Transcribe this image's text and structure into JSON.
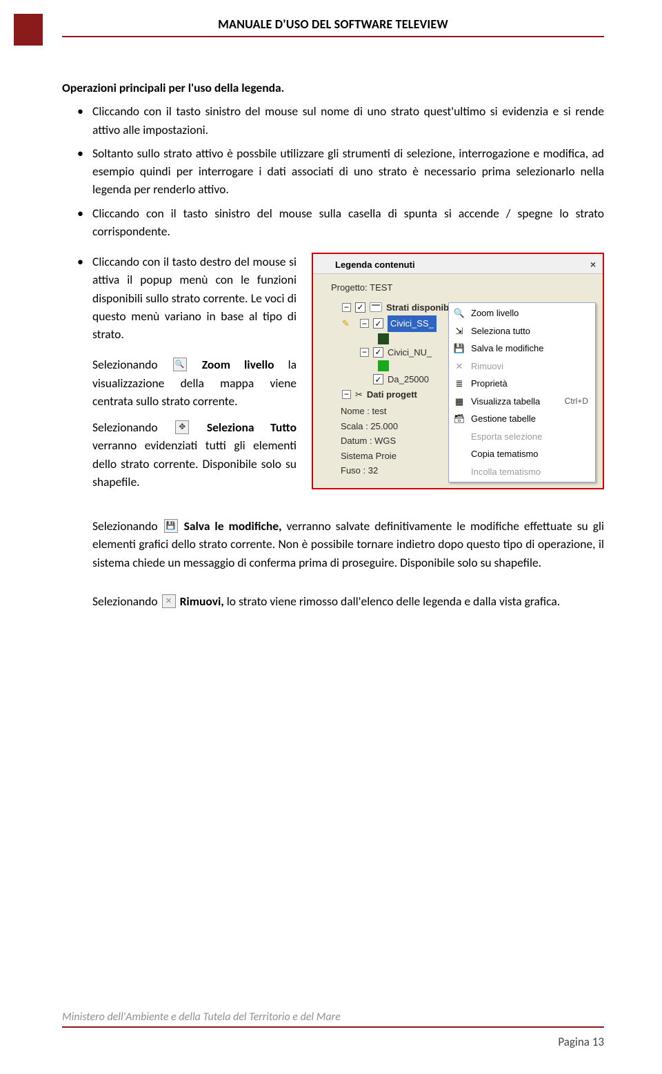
{
  "header": {
    "title": "MANUALE D'USO DEL SOFTWARE TELEVIEW"
  },
  "section_title": "Operazioni principali per l'uso della legenda.",
  "bullets_top": [
    "Cliccando con il tasto sinistro del mouse  sul nome di uno strato quest'ultimo si evidenzia e si rende attivo alle impostazioni.",
    "Soltanto sullo strato attivo è possbile utilizzare gli strumenti di selezione, interrogazione e modifica, ad esempio quindi per interrogare i dati associati di uno strato è necessario prima selezionarlo nella legenda per renderlo attivo.",
    "Cliccando con il tasto sinistro del mouse sulla casella di spunta si accende / spegne lo strato corrispondente."
  ],
  "left_column_items": [
    {
      "pre": "Cliccando con il tasto destro del mouse si attiva il popup menù con le funzioni disponibili sullo strato corrente. Le voci di questo menù variano in base al tipo di strato."
    },
    {
      "pre": "Selezionando ",
      "icon": "zoom",
      "bold": "Zoom livello",
      "post": " la visualizzazione della mappa viene centrata sullo strato corrente."
    },
    {
      "pre": "Selezionando ",
      "icon": "hand",
      "bold": "Seleziona Tutto",
      "post": " verranno evidenziati tutti gli elementi dello strato corrente. Disponibile solo su shapefile."
    }
  ],
  "lower_paragraphs": [
    {
      "pre": "Selezionando ",
      "icon": "disk",
      "bold": "Salva le modifiche,",
      "post": " verranno salvate definitivamente le modifiche effettuate su gli elementi grafici dello strato corrente. Non è possibile tornare indietro dopo questo tipo di operazione, il sistema chiede un messaggio di conferma prima di proseguire. Disponibile solo su shapefile."
    },
    {
      "pre": "Selezionando ",
      "icon": "xrem",
      "bold": "Rimuovi,",
      "post": " lo strato viene rimosso dall'elenco delle legenda e dalla vista grafica."
    }
  ],
  "legend": {
    "title": "Legenda contenuti",
    "project_label": "Progetto: TEST",
    "root_label": "Strati disponibili",
    "selected_layer": "Civici_SS_",
    "layer2": "Civici_NU_",
    "layer3": "Da_25000",
    "group_label": "Dati progett",
    "details": {
      "name": "Nome : test",
      "scale": "Scala : 25.000",
      "datum": "Datum : WGS",
      "proj": "Sistema Proie",
      "fuse": "Fuso : 32"
    }
  },
  "context_menu": {
    "items": [
      {
        "icon": "🔍",
        "label": "Zoom livello",
        "enabled": true
      },
      {
        "icon": "⇲",
        "label": "Seleziona tutto",
        "enabled": true
      },
      {
        "icon": "💾",
        "label": "Salva le modifiche",
        "enabled": true
      },
      {
        "icon": "✕",
        "label": "Rimuovi",
        "enabled": false
      },
      {
        "icon": "≣",
        "label": "Proprietà",
        "enabled": true
      },
      {
        "icon": "▦",
        "label": "Visualizza tabella",
        "enabled": true,
        "shortcut": "Ctrl+D"
      },
      {
        "icon": "🗃",
        "label": "Gestione tabelle",
        "enabled": true
      },
      {
        "icon": "",
        "label": "Esporta selezione",
        "enabled": false
      },
      {
        "icon": "",
        "label": "Copia tematismo",
        "enabled": true
      },
      {
        "icon": "",
        "label": "Incolla tematismo",
        "enabled": false
      }
    ]
  },
  "footer": {
    "org": "Ministero dell'Ambiente e della Tutela del Territorio e del Mare",
    "page": "Pagina 13"
  }
}
